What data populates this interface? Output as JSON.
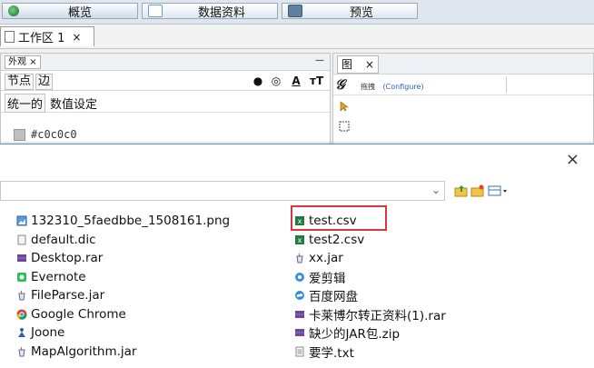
{
  "nav": {
    "tabs": [
      {
        "label": "概览",
        "color": "#2f8e3f"
      },
      {
        "label": "数据资料",
        "color": "#6a9ec9"
      },
      {
        "label": "预览",
        "color": "#5c7fa3"
      }
    ]
  },
  "workspace": {
    "tab_label": "工作区 1",
    "close": "×"
  },
  "appearance": {
    "panel_title": "外观",
    "close": "×",
    "minimize": "—",
    "subtab_nodes": "节点",
    "subtab_edges": "边",
    "row_unified": "统一的",
    "row_value": "数值设定",
    "color_value": "#c0c0c0"
  },
  "graph": {
    "tab_label": "图",
    "close": "×",
    "drag_text": "拖拽",
    "configure_text": "(Configure)"
  },
  "dialog": {
    "close": "×",
    "dropdown": "⌄",
    "files_left": [
      {
        "name": "132310_5faedbbe_1508161.png",
        "icon": "image-icon"
      },
      {
        "name": "default.dic",
        "icon": "file-icon"
      },
      {
        "name": "Desktop.rar",
        "icon": "rar-icon"
      },
      {
        "name": "Evernote",
        "icon": "evernote-icon"
      },
      {
        "name": "FileParse.jar",
        "icon": "jar-icon"
      },
      {
        "name": "Google Chrome",
        "icon": "chrome-icon"
      },
      {
        "name": "Joone",
        "icon": "joone-icon"
      },
      {
        "name": "MapAlgorithm.jar",
        "icon": "jar-icon"
      }
    ],
    "files_right": [
      {
        "name": "test.csv",
        "icon": "excel-icon"
      },
      {
        "name": "test2.csv",
        "icon": "excel-icon"
      },
      {
        "name": "xx.jar",
        "icon": "jar-icon"
      },
      {
        "name": "爱剪辑",
        "icon": "app-icon"
      },
      {
        "name": "百度网盘",
        "icon": "cloud-icon"
      },
      {
        "name": "卡莱博尔转正资料(1).rar",
        "icon": "rar-icon"
      },
      {
        "name": "缺少的JAR包.zip",
        "icon": "rar-icon"
      },
      {
        "name": "要学.txt",
        "icon": "txt-icon"
      }
    ]
  },
  "colors": {
    "highlight": "#d9363e",
    "excel": "#1f7a44"
  }
}
